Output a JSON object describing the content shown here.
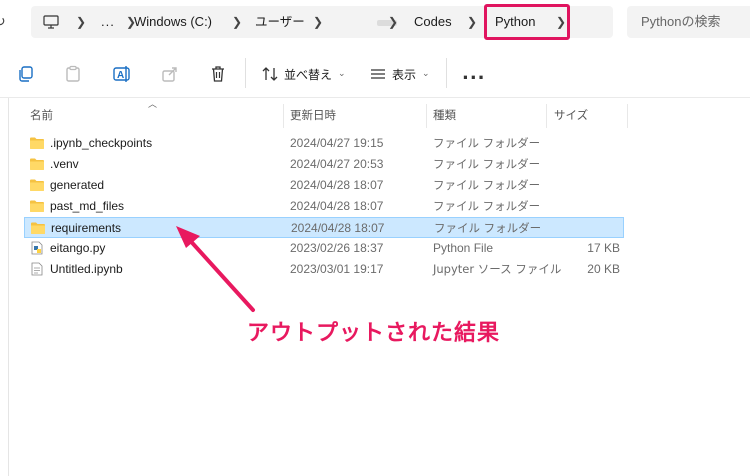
{
  "address_bar": {
    "breadcrumbs": [
      "Windows (C:)",
      "ユーザー",
      "Codes",
      "Python"
    ],
    "overflow_label": "...",
    "search_placeholder": "Pythonの検索"
  },
  "toolbar": {
    "sort_label": "並べ替え",
    "view_label": "表示",
    "more_label": "..."
  },
  "columns": {
    "name": "名前",
    "date": "更新日時",
    "type": "種類",
    "size": "サイズ"
  },
  "files": [
    {
      "name": ".ipynb_checkpoints",
      "date": "2024/04/27 19:15",
      "type": "ファイル フォルダー",
      "size": "",
      "icon": "folder-icon"
    },
    {
      "name": ".venv",
      "date": "2024/04/27 20:53",
      "type": "ファイル フォルダー",
      "size": "",
      "icon": "folder-icon"
    },
    {
      "name": "generated",
      "date": "2024/04/28 18:07",
      "type": "ファイル フォルダー",
      "size": "",
      "icon": "folder-icon"
    },
    {
      "name": "past_md_files",
      "date": "2024/04/28 18:07",
      "type": "ファイル フォルダー",
      "size": "",
      "icon": "folder-icon"
    },
    {
      "name": "requirements",
      "date": "2024/04/28 18:07",
      "type": "ファイル フォルダー",
      "size": "",
      "icon": "folder-icon",
      "selected": true
    },
    {
      "name": "eitango.py",
      "date": "2023/02/26 18:37",
      "type": "Python File",
      "size": "17 KB",
      "icon": "python-file-icon"
    },
    {
      "name": "Untitled.ipynb",
      "date": "2023/03/01 19:17",
      "type": "Jupyter ソース ファイル",
      "size": "20 KB",
      "icon": "notebook-file-icon"
    }
  ],
  "annotation": {
    "text": "アウトプットされた結果",
    "color": "#e8195f"
  },
  "colors": {
    "highlight": "#e0145f",
    "selection": "#cce8ff",
    "folder": "#f5c242"
  }
}
